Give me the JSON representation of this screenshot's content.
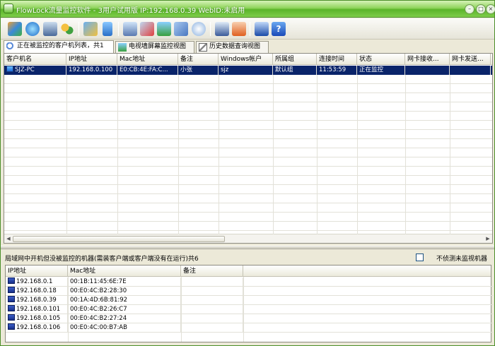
{
  "window": {
    "title": "FlowLock流量监控软件 - 3用户试用版 IP:192.168.0.39 WebID:未启用",
    "controls": [
      "min",
      "max",
      "close"
    ]
  },
  "toolbar": {
    "icons": [
      "layers-icon",
      "globe-icon",
      "monitor-settings-icon",
      "users-icon",
      "network-icon",
      "pin-icon",
      "screen-icon",
      "remote-icon",
      "picture-icon",
      "windows-icon",
      "disk-icon",
      "report-icon",
      "calendar-icon",
      "cart-icon",
      "help-icon"
    ]
  },
  "tabs": [
    {
      "label": "正在被监控的客户机列表，共1",
      "icon": "search-icon"
    },
    {
      "label": "电视墙屏幕监控视图",
      "icon": "picture-icon"
    },
    {
      "label": "历史数据查询视图",
      "icon": "edit-icon"
    }
  ],
  "clients": {
    "columns": [
      "客户机名",
      "IP地址",
      "Mac地址",
      "备注",
      "Windows帐户",
      "所属组",
      "连接时间",
      "状态",
      "网卡接收...",
      "网卡发送..."
    ],
    "rows": [
      [
        "SJZ-PC",
        "192.168.0.100",
        "E0:CB:4E:FA:C...",
        "小张",
        "sjz",
        "默认组",
        "11:53:59",
        "正在监控",
        "",
        ""
      ]
    ]
  },
  "lan": {
    "caption": "局域网中开机但没被监控的机器(需装客户端或客户端没有在运行)共6",
    "checkbox_label": "不侦测未监视机器",
    "columns": [
      "IP地址",
      "Mac地址",
      "备注"
    ],
    "rows": [
      [
        "192.168.0.1",
        "00:1B:11:45:6E:7E",
        ""
      ],
      [
        "192.168.0.18",
        "00:E0:4C:B2:28:30",
        ""
      ],
      [
        "192.168.0.39",
        "00:1A:4D:6B:81:92",
        ""
      ],
      [
        "192.168.0.101",
        "00:E0:4C:B2:26:C7",
        ""
      ],
      [
        "192.168.0.105",
        "00:E0:4C:B2:27:24",
        ""
      ],
      [
        "192.168.0.106",
        "00:E0:4C:00:B7:AB",
        ""
      ]
    ]
  },
  "colors": {
    "accent": "#5bb52a",
    "selection": "#0a246a"
  }
}
